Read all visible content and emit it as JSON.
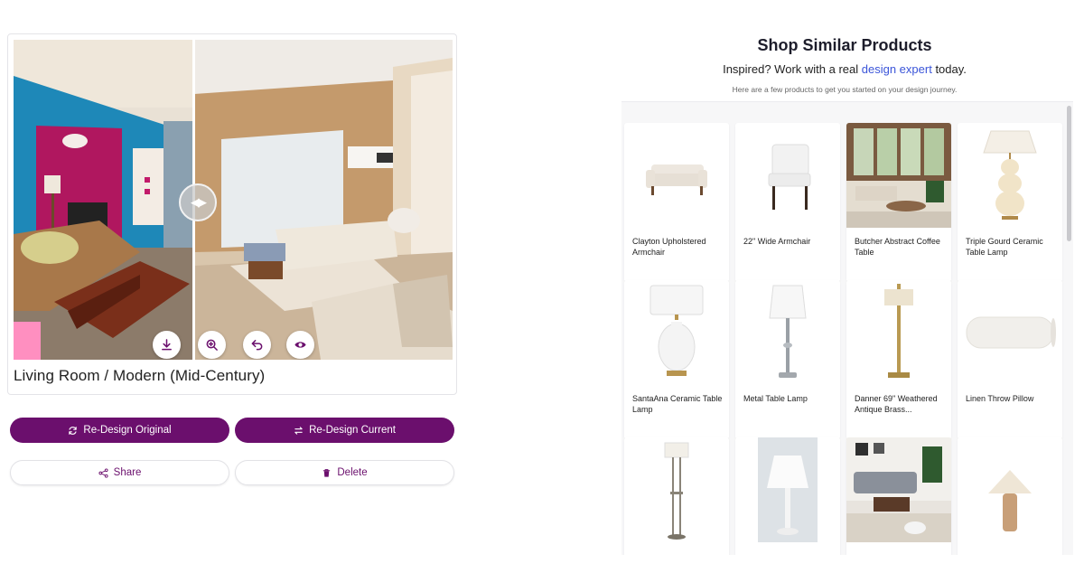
{
  "design_card": {
    "room_title": "Living Room / Modern (Mid-Century)",
    "tools": [
      {
        "icon": "download-icon"
      },
      {
        "icon": "zoom-in-icon"
      },
      {
        "icon": "undo-icon"
      },
      {
        "icon": "eye-icon"
      }
    ]
  },
  "actions": {
    "redesign_original": "Re-Design Original",
    "redesign_current": "Re-Design Current",
    "share": "Share",
    "delete": "Delete"
  },
  "shop": {
    "title": "Shop Similar Products",
    "subtitle_before": "Inspired? Work with a real ",
    "subtitle_link": "design expert",
    "subtitle_after": " today.",
    "note": "Here are a few products to get you started on your design journey.",
    "products": [
      {
        "name": "Clayton Upholstered Armchair"
      },
      {
        "name": "22\" Wide Armchair"
      },
      {
        "name": "Butcher Abstract Coffee Table"
      },
      {
        "name": "Triple Gourd Ceramic Table Lamp"
      },
      {
        "name": "SantaAna Ceramic Table Lamp"
      },
      {
        "name": "Metal Table Lamp"
      },
      {
        "name": "Danner 69\" Weathered Antique Brass..."
      },
      {
        "name": "Linen Throw Pillow"
      },
      {
        "name": ""
      },
      {
        "name": ""
      },
      {
        "name": ""
      },
      {
        "name": ""
      }
    ]
  },
  "colors": {
    "brand_purple": "#6b0f6d",
    "link_blue": "#3b55d9"
  }
}
